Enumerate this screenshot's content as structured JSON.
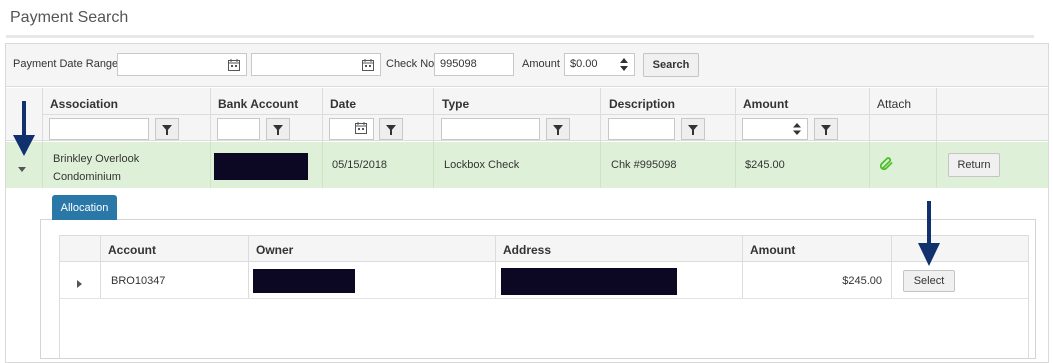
{
  "page": {
    "title": "Payment Search"
  },
  "filters": {
    "date_range_label": "Payment Date Range",
    "date_from": "",
    "date_to": "",
    "check_no_label": "Check No",
    "check_no_value": "995098",
    "amount_label": "Amount",
    "amount_value": "$0.00",
    "search_label": "Search"
  },
  "grid": {
    "columns": [
      "Association",
      "Bank Account",
      "Date",
      "Type",
      "Description",
      "Amount",
      "Attach"
    ],
    "row": {
      "association": "Brinkley Overlook Condominium",
      "bank_account": "",
      "date": "05/15/2018",
      "type": "Lockbox Check",
      "description": "Chk #995098",
      "amount": "$245.00",
      "return_label": "Return"
    }
  },
  "allocation": {
    "tab_label": "Allocation",
    "columns": [
      "Account",
      "Owner",
      "Address",
      "Amount"
    ],
    "row": {
      "account": "BRO10347",
      "owner": "",
      "address": "",
      "amount": "$245.00",
      "select_label": "Select"
    }
  },
  "icons": {
    "calendar": "calendar-icon",
    "filter": "filter-icon",
    "attach": "paperclip-icon",
    "expand": "expand-caret-icon",
    "annotation": "arrow-down-icon"
  },
  "colors": {
    "row_highlight": "#dff0d8",
    "tab_blue": "#2a78a8",
    "attach_green": "#4cbf2b",
    "annotation_arrow": "#10306e"
  }
}
